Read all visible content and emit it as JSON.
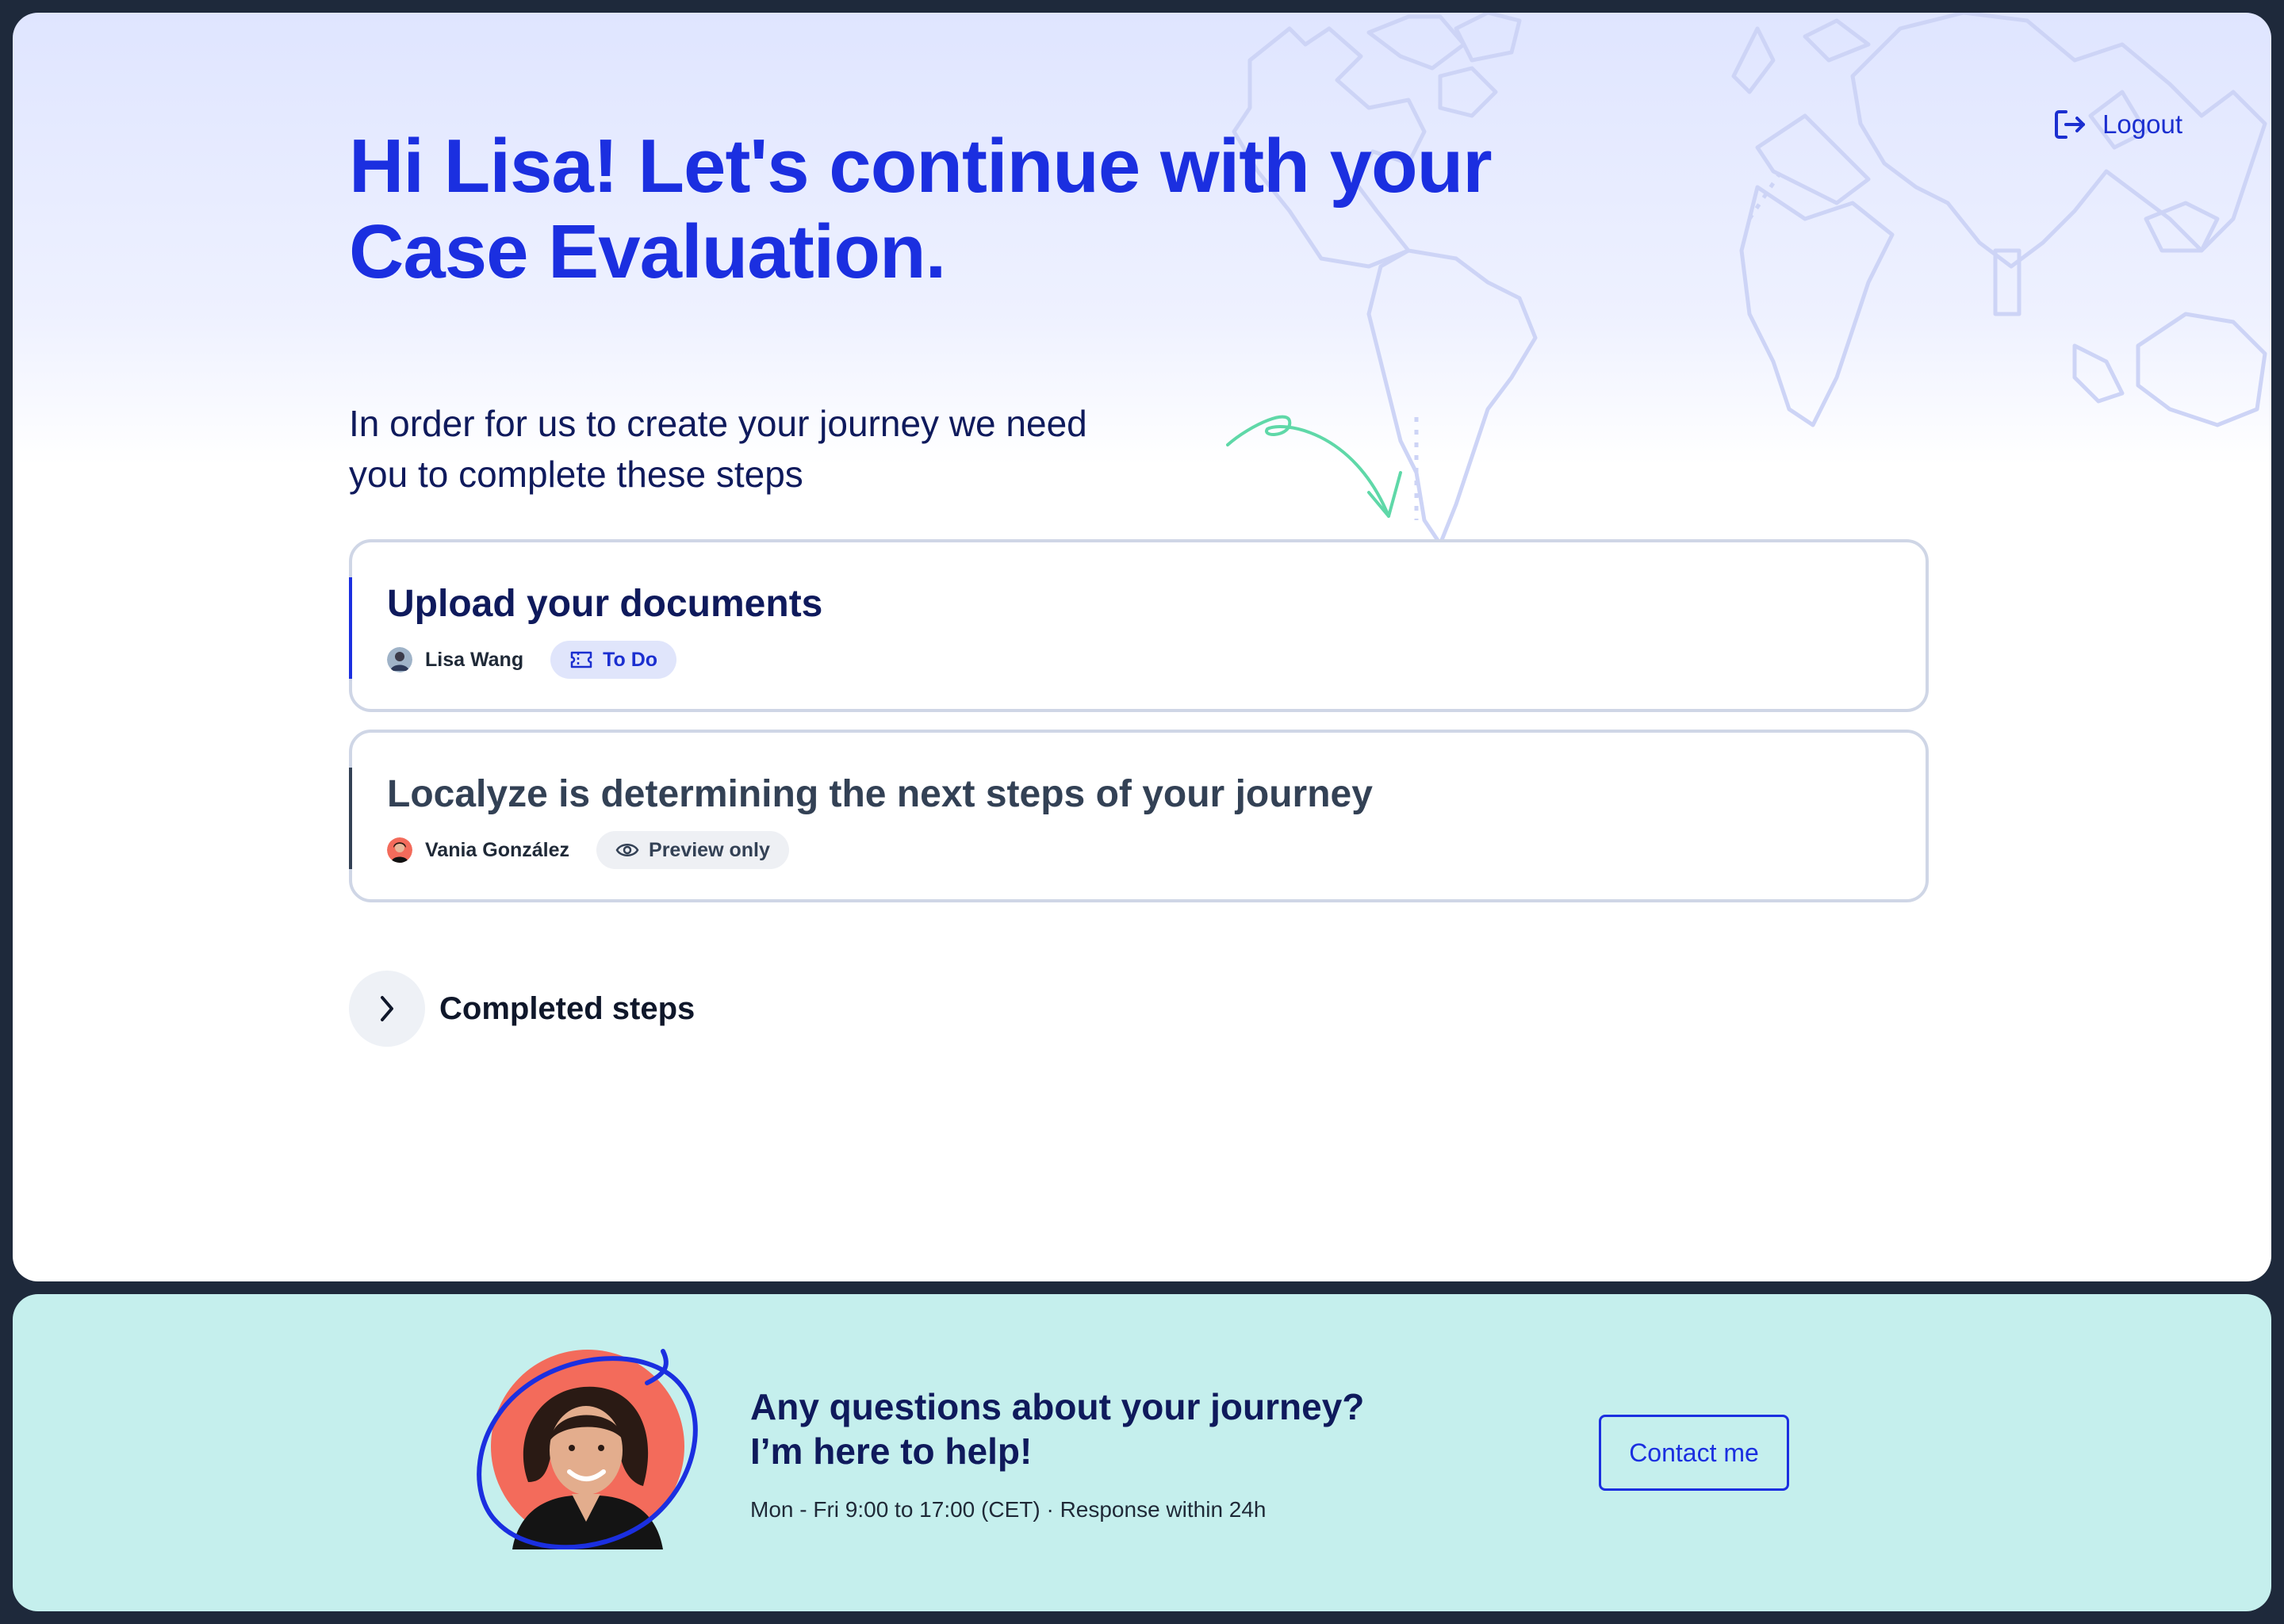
{
  "header": {
    "logout_label": "Logout",
    "greeting_line1": "Hi Lisa! Let's continue with your",
    "greeting_line2": "Case Evaluation.",
    "intro_line1": "In order for us to create your journey we need",
    "intro_line2": "you to complete these steps"
  },
  "steps": [
    {
      "title": "Upload your documents",
      "assignee": "Lisa Wang",
      "status": "To Do",
      "status_icon": "ticket-icon"
    },
    {
      "title": "Localyze is determining the next steps of your journey",
      "assignee": "Vania González",
      "status": "Preview only",
      "status_icon": "eye-icon"
    }
  ],
  "completed_steps_label": "Completed steps",
  "help": {
    "title_line1": "Any questions about your journey?",
    "title_line2": "I’m here to help!",
    "hours": "Mon - Fri 9:00 to 17:00 (CET) · Response within 24h",
    "contact_label": "Contact me"
  },
  "colors": {
    "accent": "#1b2fe0",
    "navy": "#0f1a5c",
    "frame": "#1e293b",
    "help_bg": "#c5efed",
    "arrow": "#5fd8a8",
    "avatar_bg": "#f36b5b"
  }
}
